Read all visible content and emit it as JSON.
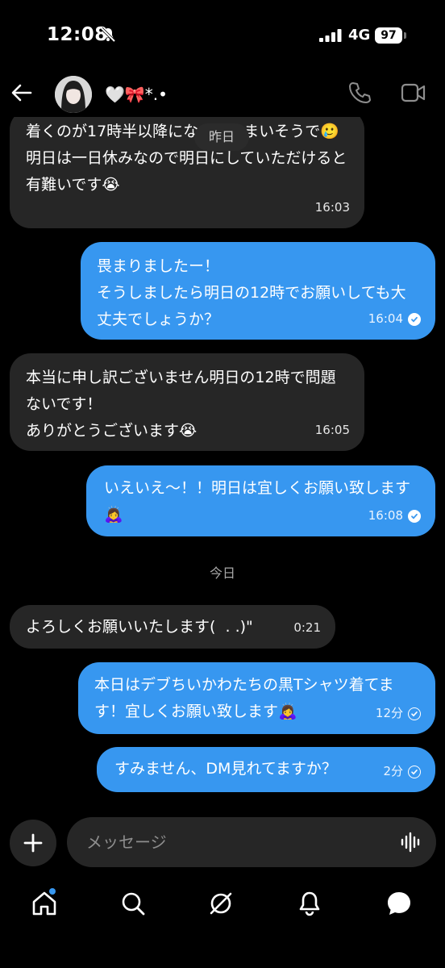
{
  "status_bar": {
    "time": "12:08",
    "network": "4G",
    "battery": "97"
  },
  "header": {
    "contact_name": "🤍🎀*.•"
  },
  "thread": {
    "day_pill": "昨日",
    "messages": [
      {
        "side": "in",
        "text": "着くのが17時半以降になってしまいそうで🥲\n明日は一日休みなので明日にしていただけると有難いです😭",
        "time": "16:03"
      },
      {
        "side": "out",
        "text": "畏まりましたー！\nそうしましたら明日の12時でお願いしても大丈夫でしょうか？",
        "time": "16:04",
        "read": true
      },
      {
        "side": "in",
        "text": "本当に申し訳ございません明日の12時で問題ないです！\nありがとうございます😭",
        "time": "16:05"
      },
      {
        "side": "out",
        "text": "いえいえ〜！！明日は宜しくお願い致します🙇‍♀️",
        "time": "16:08",
        "read": true
      },
      {
        "side": "in",
        "text": "よろしくお願いいたします(  . .)\"",
        "time": "0:21"
      },
      {
        "side": "out",
        "text": "本日はデブちいかわたちの黒Tシャツ着てます！宜しくお願い致します🙇‍♀️",
        "time": "12分",
        "read": false
      },
      {
        "side": "out",
        "text": "すみません、DM見れてますか？",
        "time": "2分",
        "read": false
      }
    ],
    "today_label": "今日"
  },
  "composer": {
    "placeholder": "メッセージ"
  },
  "colors": {
    "outgoing": "#3797f0",
    "incoming": "#262626",
    "background": "#000000"
  }
}
